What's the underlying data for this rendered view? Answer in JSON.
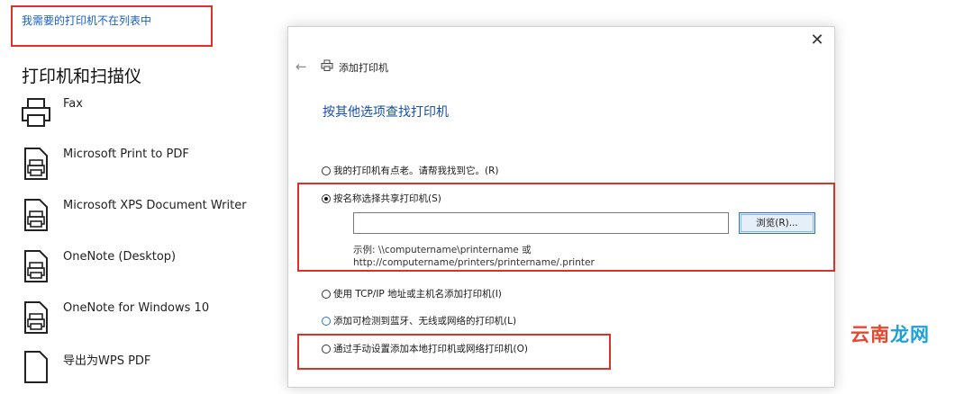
{
  "settings": {
    "missing_printer_link": "我需要的打印机不在列表中",
    "section_title": "打印机和扫描仪",
    "printers": [
      {
        "name": "Fax",
        "icon": "fax-printer-icon"
      },
      {
        "name": "Microsoft Print to PDF",
        "icon": "printer-doc-icon"
      },
      {
        "name": "Microsoft XPS Document Writer",
        "icon": "printer-doc-icon"
      },
      {
        "name": "OneNote (Desktop)",
        "icon": "printer-doc-icon"
      },
      {
        "name": "OneNote for Windows 10",
        "icon": "printer-doc-icon"
      },
      {
        "name": "导出为WPS PDF",
        "icon": "printer-doc-icon"
      }
    ]
  },
  "dialog": {
    "title": "添加打印机",
    "heading": "按其他选项查找打印机",
    "close": "✕",
    "back": "←",
    "options": [
      {
        "label": "我的打印机有点老。请帮我找到它。(R)",
        "selected": false
      },
      {
        "label": "按名称选择共享打印机(S)",
        "selected": true
      },
      {
        "label": "使用 TCP/IP 地址或主机名添加打印机(I)",
        "selected": false
      },
      {
        "label": "添加可检测到蓝牙、无线或网络的打印机(L)",
        "selected": false
      },
      {
        "label": "通过手动设置添加本地打印机或网络打印机(O)",
        "selected": false
      }
    ],
    "share_name_value": "",
    "browse_label": "浏览(R)...",
    "example_line1": "示例: \\\\computername\\printername 或",
    "example_line2": "http://computername/printers/printername/.printer"
  },
  "watermark": {
    "part1": "云南",
    "part2": "龙网"
  },
  "colors": {
    "highlight": "#d93328",
    "link": "#1761c9",
    "heading": "#1750a8"
  }
}
